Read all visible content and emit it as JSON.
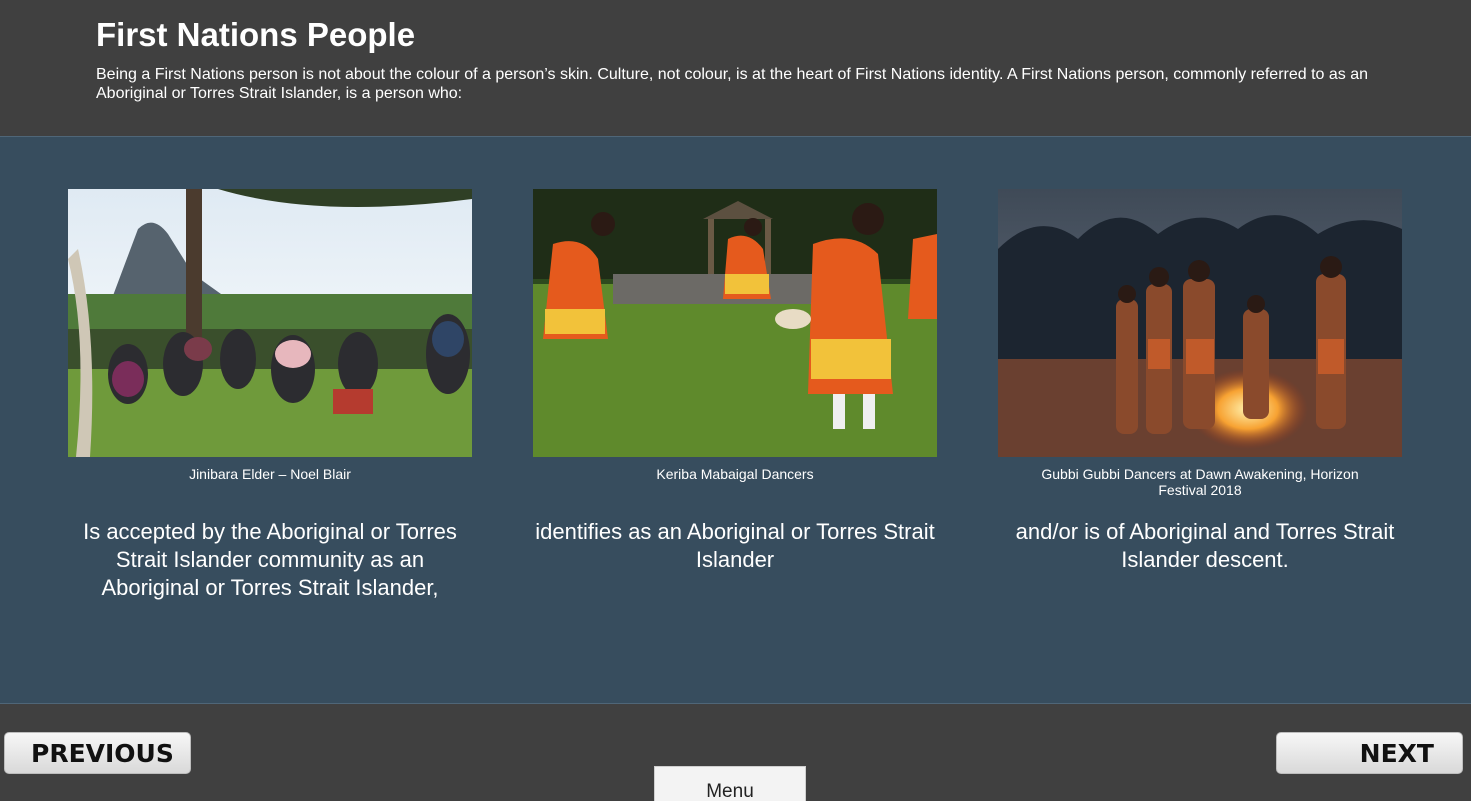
{
  "header": {
    "title": "First Nations People",
    "intro": "Being a First Nations person is not about the colour of a person’s skin. Culture, not colour, is at the heart of First Nations identity.  A First Nations person, commonly referred to as an Aboriginal or Torres Strait Islander, is a person who:"
  },
  "cards": [
    {
      "caption": "Jinibara Elder – Noel Blair",
      "statement": "Is accepted by the Aboriginal or Torres Strait Islander community as an Aboriginal or Torres Strait Islander,"
    },
    {
      "caption": "Keriba Mabaigal Dancers",
      "statement": "identifies as an Aboriginal or Torres Strait Islander"
    },
    {
      "caption": "Gubbi Gubbi Dancers at Dawn Awakening, Horizon Festival 2018",
      "statement": "and/or is of Aboriginal and Torres Strait Islander descent."
    }
  ],
  "nav": {
    "previous_label": "PREVIOUS",
    "next_label": "NEXT",
    "menu_label": "Menu"
  },
  "colors": {
    "header_bg": "#404040",
    "panel_bg": "#374d5e",
    "text": "#ffffff"
  }
}
